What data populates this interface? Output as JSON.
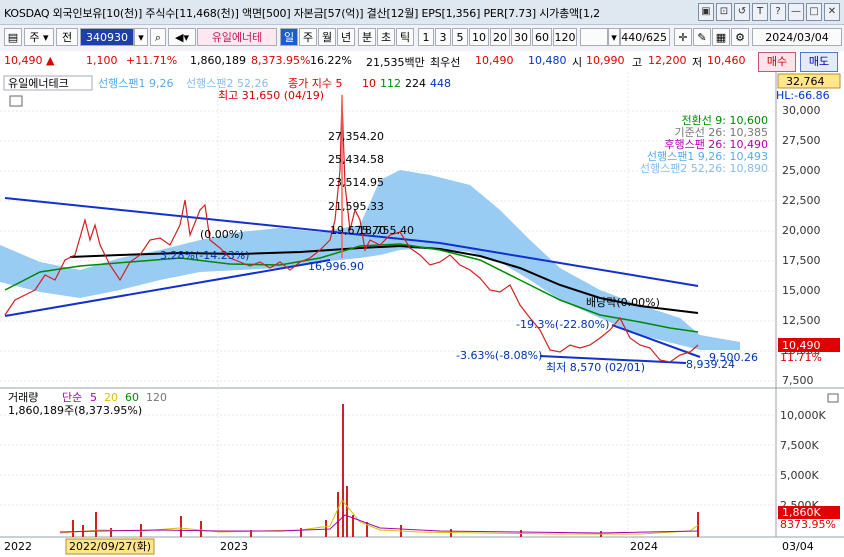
{
  "window": {
    "title": "KOSDAQ 외국인보유[10(천)] 주식수[11,468(천)] 액면[500] 자본금[57(억)] 결산[12월] EPS[1,356] PER[7.73] 시가총액[1,2",
    "buttons": [
      "▣",
      "⊡",
      "↺",
      "T",
      "?",
      "—",
      "□",
      "✕"
    ]
  },
  "toolbar": {
    "market": "주",
    "period_prefix": "전",
    "code": "340930",
    "name": "유일에너테",
    "tabs": [
      "일",
      "주",
      "월",
      "년",
      "분",
      "초",
      "틱"
    ],
    "selected_tab": "일",
    "intervals": [
      "1",
      "3",
      "5",
      "10",
      "20",
      "30",
      "60",
      "120"
    ],
    "count": "440",
    "total": "/625",
    "date": "2024/03/04"
  },
  "quote": {
    "price": "10,490",
    "change": "1,100",
    "change_pct": "+11.71%",
    "volume": "1,860,189",
    "volume_pct": "8,373.95%",
    "turnover_rate": "16.22%",
    "amount": "21,535백만",
    "best_ask_label": "최우선",
    "best_ask": "10,490",
    "best_bid": "10,480",
    "open_label": "시",
    "open": "10,990",
    "high_label": "고",
    "high": "12,200",
    "low_label": "저",
    "low": "10,460",
    "buy_label": "매수",
    "sell_label": "매도"
  },
  "price_panel": {
    "name": "유일에너테크",
    "legend_ichimoku1": "선행스팬1 9,26",
    "legend_ichimoku2": "선행스팬2 52,26",
    "legend_ma": "종가 지수 5",
    "legend_ma_values": [
      "10",
      "112",
      "224",
      "448"
    ],
    "current_top": "32,764",
    "hl_label": "HL:-66.86",
    "current_price": "10,490",
    "current_pct": "11.71%",
    "ichimoku_readout": [
      {
        "label": "전환선 9: 10,600",
        "color": "#008800"
      },
      {
        "label": "기준선 26: 10,385",
        "color": "#777777"
      },
      {
        "label": "후행스팬 26: 10,490",
        "color": "#b000b0"
      },
      {
        "label": "선행스팬1 9,26: 10,493",
        "color": "#55aaee"
      },
      {
        "label": "선행스팬2 52,26: 10,890",
        "color": "#88bbee"
      }
    ],
    "annotations": {
      "high": "최고 31,650 (04/19)",
      "low": "최저 8,570 (02/01)",
      "fib": [
        "27,354.20",
        "25,434.58",
        "23,514.95",
        "21,595.33",
        "19,675.70",
        "18,755.40"
      ],
      "pct1": "3.28%(-14.23%)",
      "pct2": "(0.00%)",
      "pct3": "-19.3%(-22.80%)",
      "pct4": "배당락(0.00%)",
      "pct5": "-3.63%(-8.08%)",
      "level1": "16,996.90",
      "level2": "9,500.26",
      "level3": "8,939.24"
    },
    "yaxis": [
      "30,000",
      "27,500",
      "25,000",
      "22,500",
      "20,000",
      "17,500",
      "15,000",
      "12,500",
      "10,000",
      "7,500"
    ]
  },
  "volume_panel": {
    "label": "거래량",
    "ma_label": "단순",
    "ma_values": [
      "5",
      "20",
      "60",
      "120"
    ],
    "readout": "1,860,189주(8,373.95%)",
    "yaxis": [
      "10,000K",
      "7,500K",
      "5,000K",
      "2,500K"
    ],
    "current": "1,860K",
    "current_pct": "8373.95%"
  },
  "xaxis": {
    "labels": [
      "2022",
      "2022/09/27(화)",
      "2023",
      "2024"
    ],
    "right_label": "03/04"
  }
}
